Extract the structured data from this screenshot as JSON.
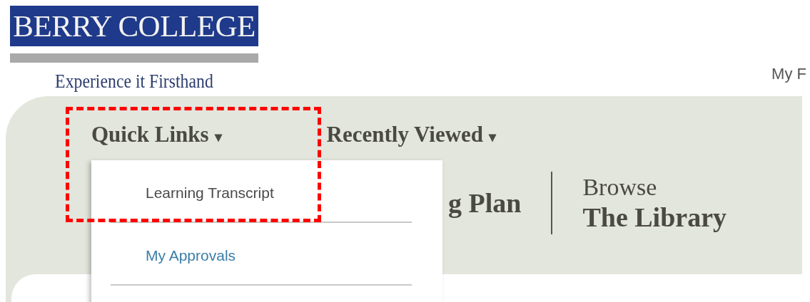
{
  "logo": {
    "title": "BERRY COLLEGE",
    "tagline": "Experience it Firsthand"
  },
  "header_link": "My F",
  "nav": [
    {
      "label": "Quick Links",
      "menu": [
        {
          "label": "Learning Transcript",
          "kind": "plain"
        },
        {
          "label": "My Approvals",
          "kind": "link"
        }
      ]
    },
    {
      "label": "Recently Viewed"
    }
  ],
  "caret": "▾",
  "tiles": [
    {
      "title": "g Plan"
    },
    {
      "subtitle": "Browse",
      "title": "The Library"
    }
  ]
}
